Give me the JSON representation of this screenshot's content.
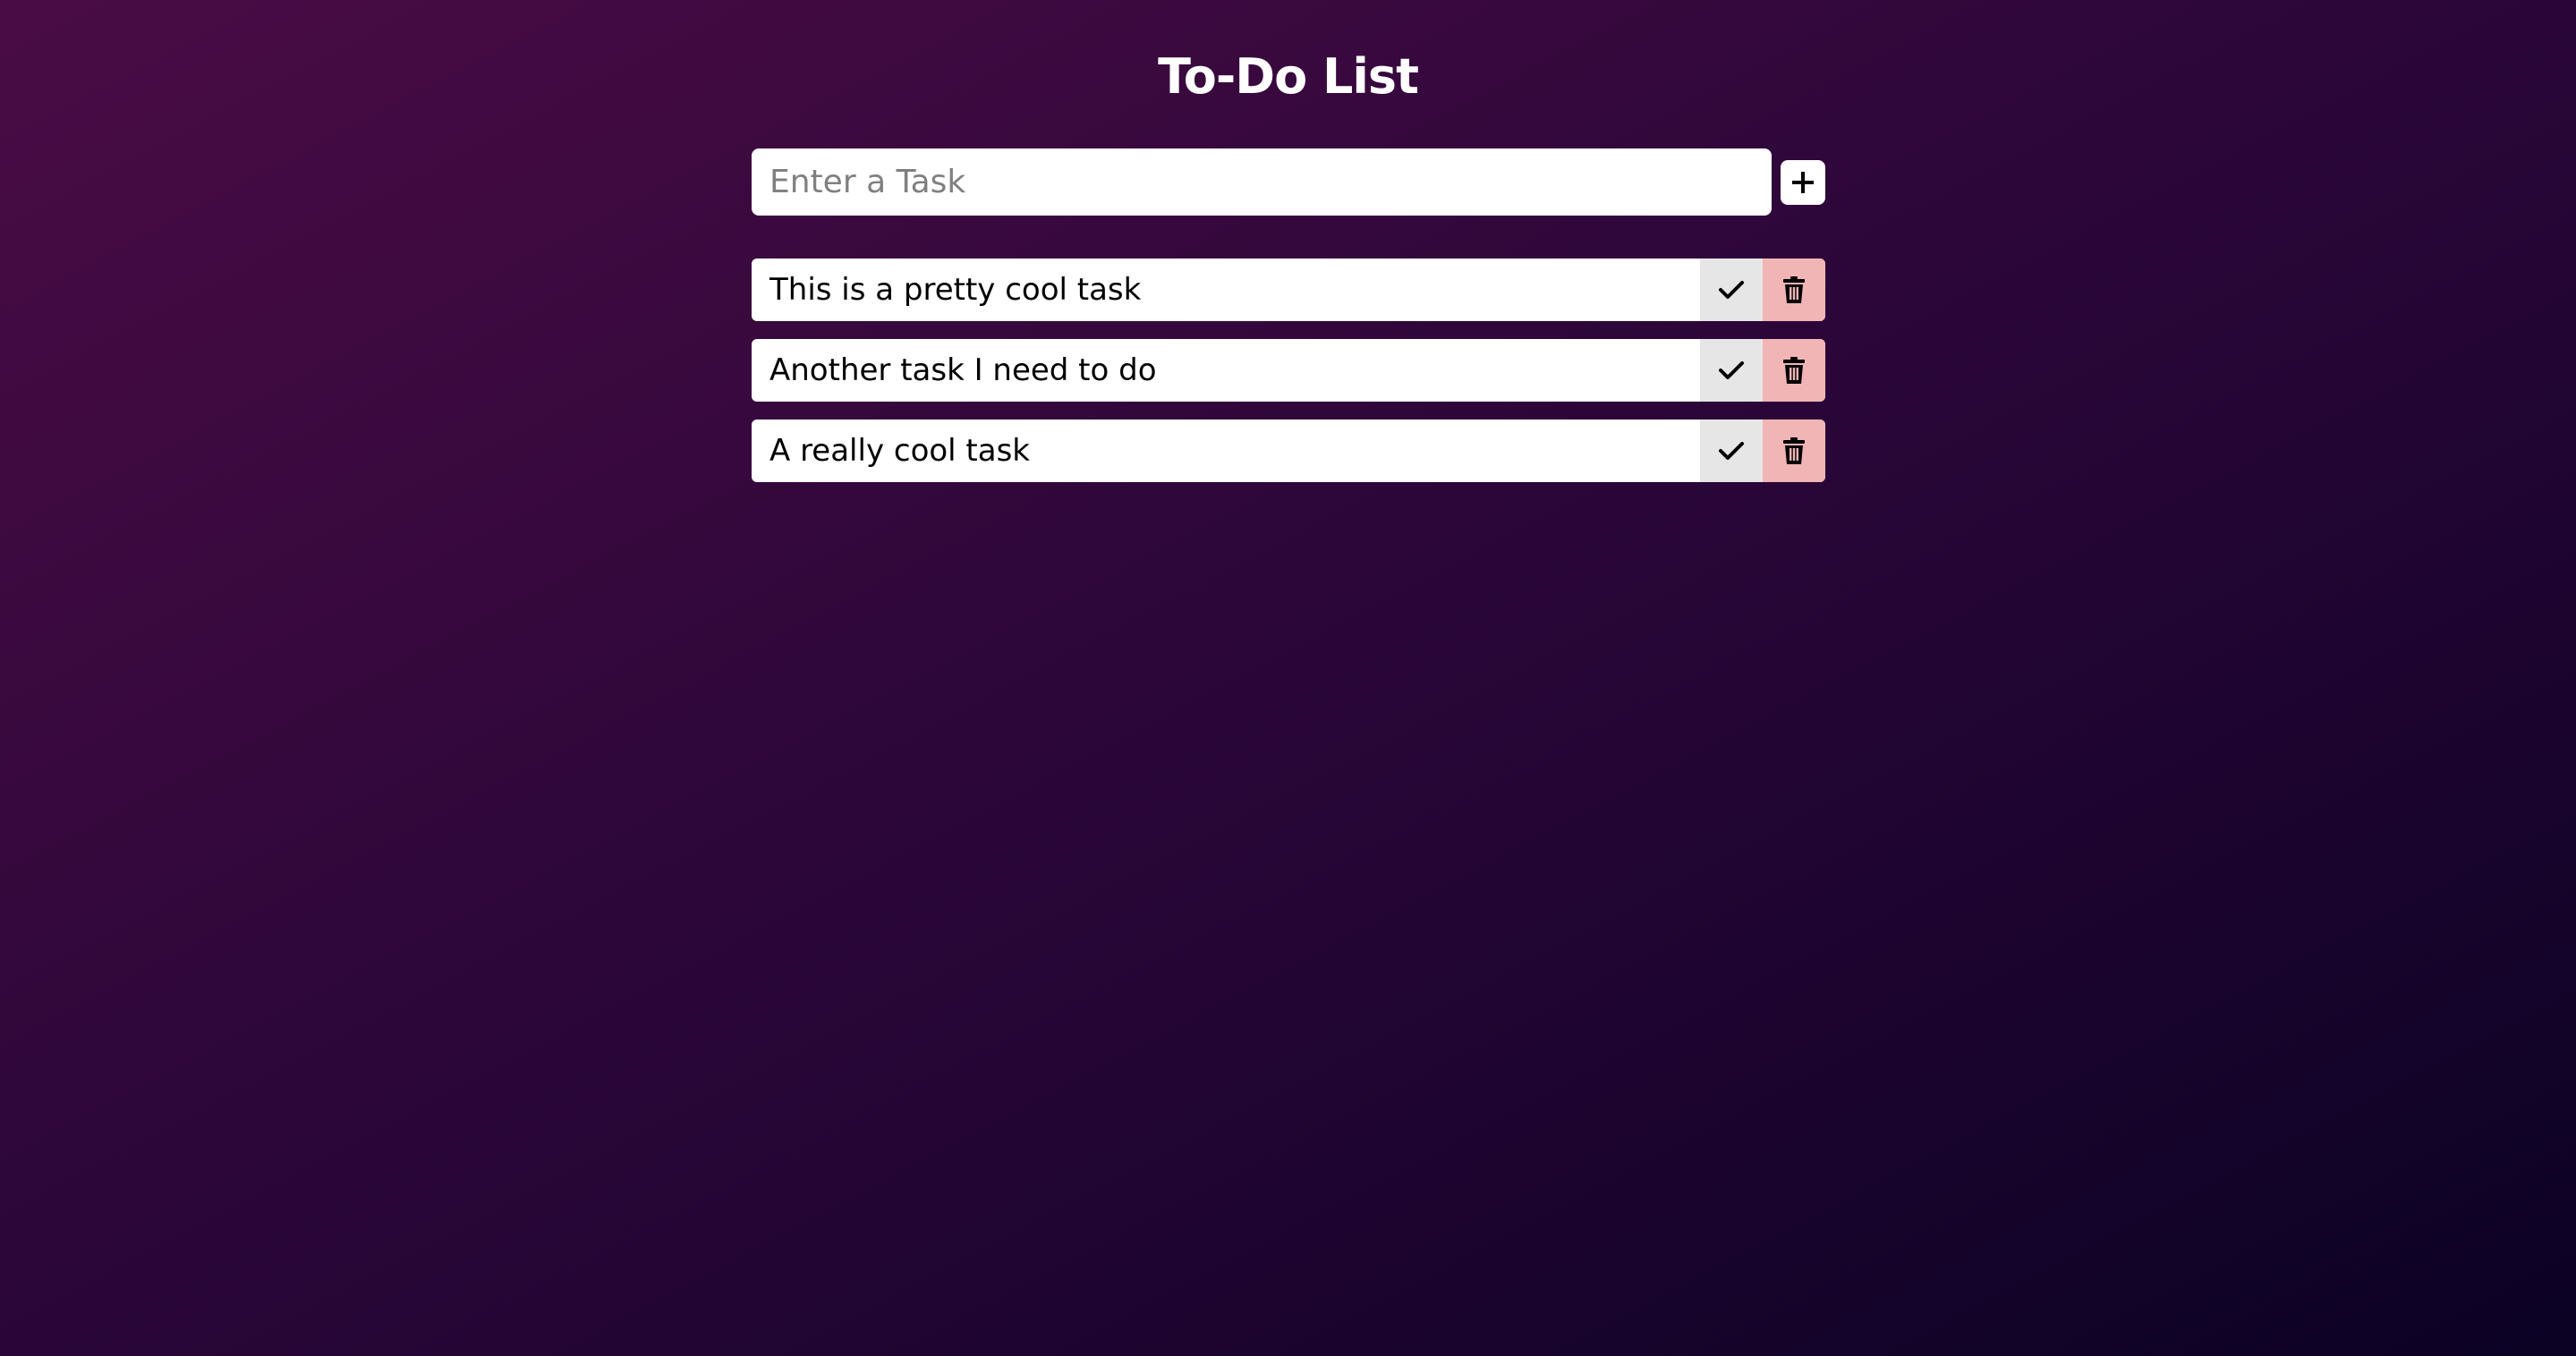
{
  "app": {
    "title": "To-Do List"
  },
  "new_task": {
    "placeholder": "Enter a Task",
    "value": "",
    "add_icon": "plus-icon"
  },
  "tasks": [
    {
      "text": "This is a pretty cool task",
      "complete_icon": "check-icon",
      "delete_icon": "trash-icon"
    },
    {
      "text": "Another task I need to do",
      "complete_icon": "check-icon",
      "delete_icon": "trash-icon"
    },
    {
      "text": "A really cool task",
      "complete_icon": "check-icon",
      "delete_icon": "trash-icon"
    }
  ],
  "colors": {
    "background_start": "#4a0c45",
    "background_end": "#0b0224",
    "complete_button": "#e6e6e6",
    "delete_button": "#f1b5b5",
    "card": "#ffffff"
  }
}
